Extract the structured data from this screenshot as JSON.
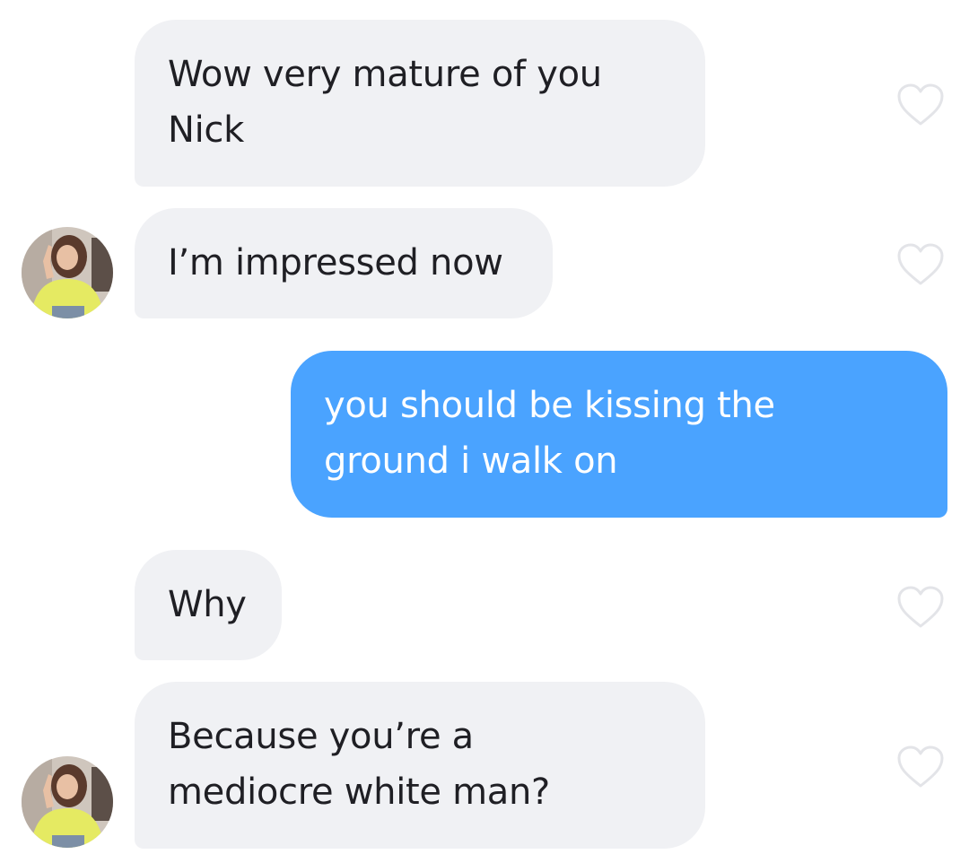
{
  "conversation": {
    "messages": [
      {
        "id": "m1",
        "direction": "incoming",
        "text": "Wow very mature of you\nNick",
        "show_avatar": false,
        "show_like": true
      },
      {
        "id": "m2",
        "direction": "incoming",
        "text": "I’m impressed now",
        "show_avatar": true,
        "show_like": true
      },
      {
        "id": "m3",
        "direction": "outgoing",
        "text": "you should be kissing the\nground i walk on",
        "show_avatar": false,
        "show_like": false
      },
      {
        "id": "m4",
        "direction": "incoming",
        "text": "Why",
        "show_avatar": false,
        "show_like": true
      },
      {
        "id": "m5",
        "direction": "incoming",
        "text": "Because you’re a\nmediocre white man?",
        "show_avatar": true,
        "show_like": true
      }
    ]
  },
  "colors": {
    "incoming_bubble": "#f0f1f4",
    "outgoing_bubble": "#4aa3ff",
    "incoming_text": "#1f1f24",
    "outgoing_text": "#ffffff",
    "like_icon_stroke": "#e3e4e8"
  },
  "icons": {
    "like": "heart-outline-icon",
    "avatar": "profile-photo"
  }
}
